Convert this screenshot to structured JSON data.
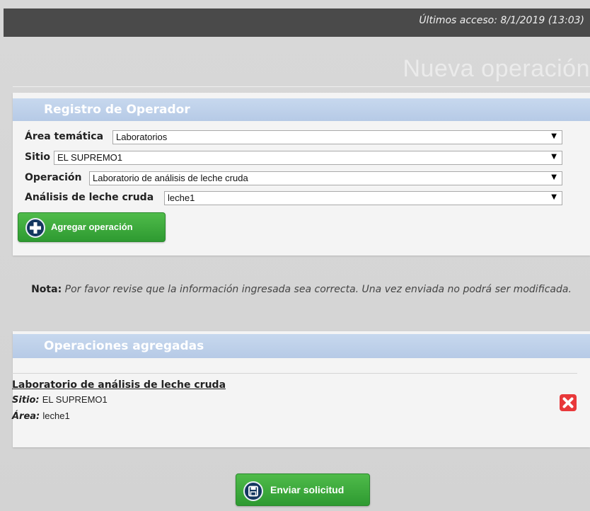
{
  "header": {
    "last_access": "Últimos acceso: 8/1/2019 (13:03)"
  },
  "page": {
    "title": "Nueva operación"
  },
  "registro": {
    "header": "Registro de Operador",
    "fields": [
      {
        "label": "Área temática",
        "value": "Laboratorios"
      },
      {
        "label": "Sitio",
        "value": "EL SUPREMO1"
      },
      {
        "label": "Operación",
        "value": "Laboratorio de análisis de leche cruda"
      },
      {
        "label": "Análisis de leche cruda",
        "value": "leche1"
      }
    ],
    "add_button": "Agregar operación",
    "add_icon": "plus-circle-icon"
  },
  "note": {
    "label": "Nota:",
    "text": "Por favor revise que la información ingresada sea correcta. Una vez enviada no podrá ser modificada."
  },
  "operaciones": {
    "header": "Operaciones agregadas",
    "items": [
      {
        "name": "Laboratorio de análisis de leche cruda",
        "sitio_label": "Sitio:",
        "sitio_value": "EL SUPREMO1",
        "area_label": "Área:",
        "area_value": "leche1",
        "delete_icon": "close-icon"
      }
    ]
  },
  "submit": {
    "label": "Enviar solicitud",
    "icon": "save-icon"
  },
  "colors": {
    "top_bar": "#4a4a4a",
    "panel_header": "#b6cae6",
    "green_button": "#3aa83a",
    "delete_red": "#e8383a"
  }
}
